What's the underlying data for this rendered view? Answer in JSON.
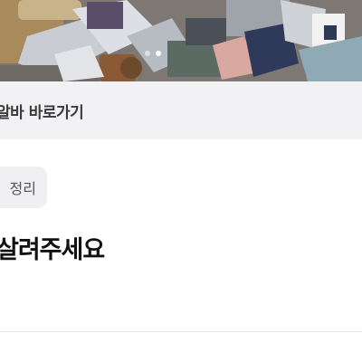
{
  "banner": {
    "slides_total": 2,
    "slide_active": 2
  },
  "shortcut": {
    "label": "알바 바로가기"
  },
  "post": {
    "category": "정리",
    "title": "살려주세요"
  }
}
